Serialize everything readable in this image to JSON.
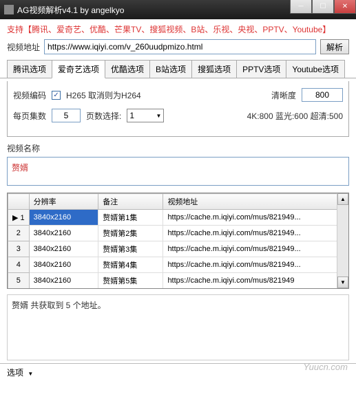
{
  "window": {
    "title": "AG视频解析v4.1 by angelkyo"
  },
  "support": "支持【腾讯、爱奇艺、优酷、芒果TV、搜狐视频、B站、乐视、央视、PPTV、Youtube】",
  "url_row": {
    "label": "视频地址",
    "value": "https://www.iqiyi.com/v_260uudpmizo.html",
    "parse_btn": "解析"
  },
  "tabs": [
    "腾讯选项",
    "爱奇艺选项",
    "优酷选项",
    "B站选项",
    "搜狐选项",
    "PPTV选项",
    "Youtube选项"
  ],
  "active_tab": 1,
  "panel": {
    "encode_label": "视频编码",
    "encode_checked": "✓",
    "encode_desc": "H265 取消则为H264",
    "clarity_label": "清晰度",
    "clarity_value": "800",
    "per_page_label": "每页集数",
    "per_page_value": "5",
    "page_select_label": "页数选择:",
    "page_select_value": "1",
    "quality_hint": "4K:800 蓝光:600 超清:500"
  },
  "name_section": {
    "label": "视频名称",
    "value": "赘婿"
  },
  "grid": {
    "headers": [
      "",
      "分辨率",
      "备注",
      "视频地址"
    ],
    "rows": [
      {
        "idx": "1",
        "res": "3840x2160",
        "note": "赘婿第1集",
        "url": "https://cache.m.iqiyi.com/mus/821949...",
        "sel": true,
        "cursor": "▶"
      },
      {
        "idx": "2",
        "res": "3840x2160",
        "note": "赘婿第2集",
        "url": "https://cache.m.iqiyi.com/mus/821949..."
      },
      {
        "idx": "3",
        "res": "3840x2160",
        "note": "赘婿第3集",
        "url": "https://cache.m.iqiyi.com/mus/821949..."
      },
      {
        "idx": "4",
        "res": "3840x2160",
        "note": "赘婿第4集",
        "url": "https://cache.m.iqiyi.com/mus/821949..."
      },
      {
        "idx": "5",
        "res": "3840x2160",
        "note": "赘婿第5集",
        "url": "https://cache.m.iqiyi.com/mus/821949"
      }
    ]
  },
  "status": "赘婿 共获取到 5 个地址。",
  "watermark": "Yuucn.com",
  "footer": {
    "options": "选项"
  }
}
